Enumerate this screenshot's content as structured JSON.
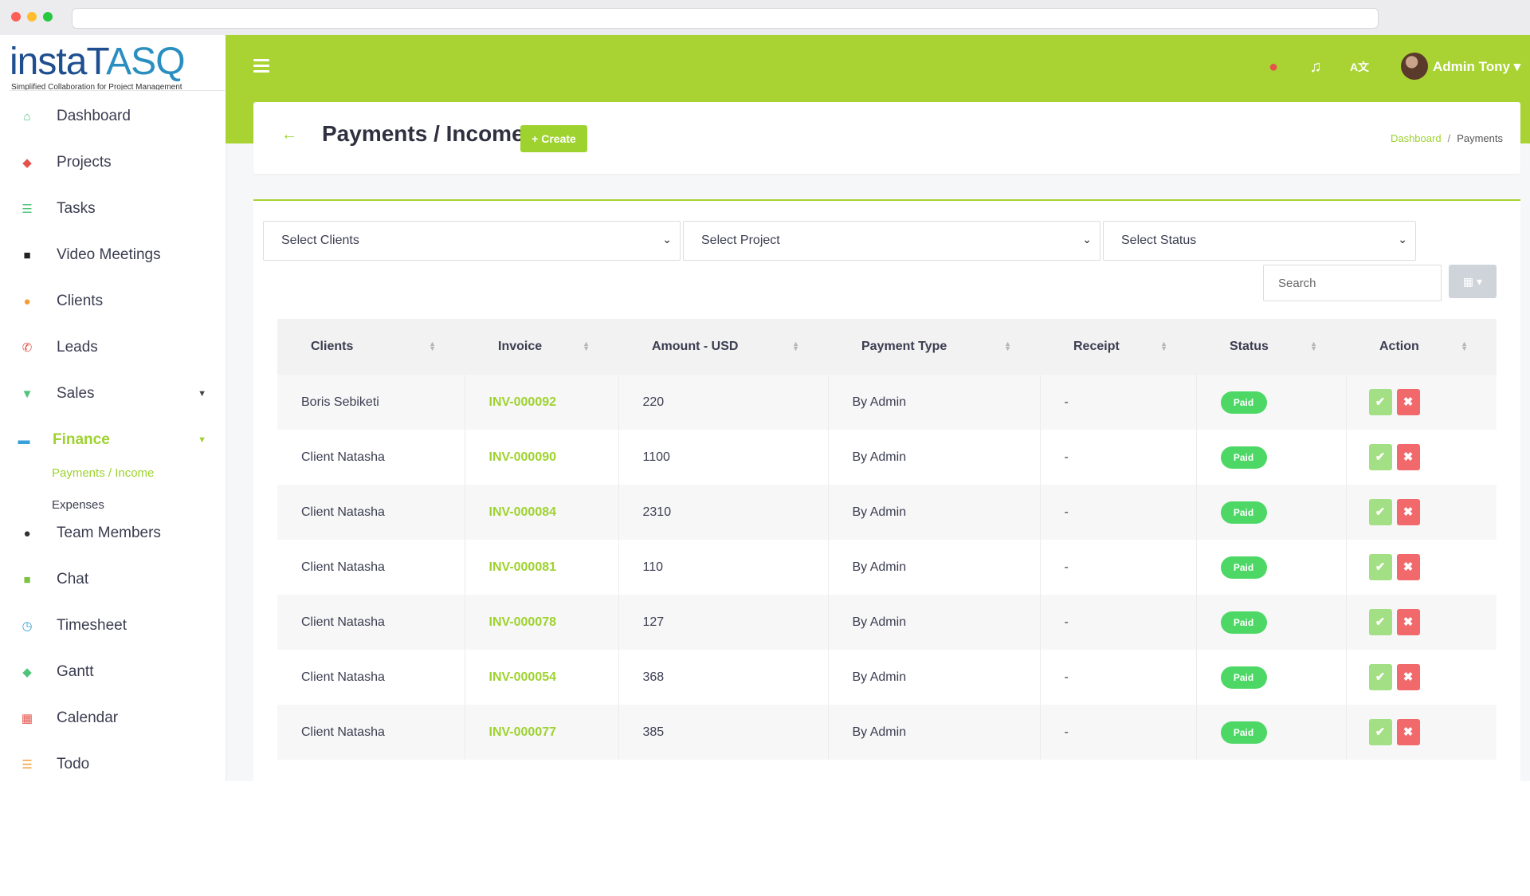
{
  "app": {
    "logo_main": "instaT",
    "logo_accent": "ASQ",
    "logo_tagline": "Simplified Collaboration for Project Management"
  },
  "sidebar": {
    "items": [
      {
        "label": "Dashboard",
        "icon": "home-icon",
        "color": "#4ec47a"
      },
      {
        "label": "Projects",
        "icon": "layers-icon",
        "color": "#e5534b"
      },
      {
        "label": "Tasks",
        "icon": "list-icon",
        "color": "#4ec47a"
      },
      {
        "label": "Video Meetings",
        "icon": "video-icon",
        "color": "#222222"
      },
      {
        "label": "Clients",
        "icon": "handshake-icon",
        "color": "#f39c34"
      },
      {
        "label": "Leads",
        "icon": "phone-icon",
        "color": "#e5534b"
      },
      {
        "label": "Sales",
        "icon": "cart-icon",
        "color": "#4ec47a"
      },
      {
        "label": "Finance",
        "icon": "credit-card-icon",
        "color": "#3aa0d8"
      },
      {
        "label": "Team Members",
        "icon": "users-icon",
        "color": "#333333"
      },
      {
        "label": "Chat",
        "icon": "chat-icon",
        "color": "#7cc243"
      },
      {
        "label": "Timesheet",
        "icon": "clock-icon",
        "color": "#3aa0d8"
      },
      {
        "label": "Gantt",
        "icon": "layers-icon",
        "color": "#4ec47a"
      },
      {
        "label": "Calendar",
        "icon": "calendar-icon",
        "color": "#e5534b"
      },
      {
        "label": "Todo",
        "icon": "list-icon",
        "color": "#f39c34"
      }
    ],
    "finance_sub": [
      "Payments / Income",
      "Expenses"
    ]
  },
  "topbar": {
    "user_name": "Admin Tony ▾",
    "icons": [
      "stopwatch-icon",
      "bell-icon",
      "language-icon"
    ],
    "accent": "#a8d332"
  },
  "header": {
    "title": "Payments / Income",
    "create_label": "+ Create",
    "breadcrumb_home": "Dashboard",
    "breadcrumb_sep": "/",
    "breadcrumb_current": "Payments"
  },
  "filters": {
    "clients": "Select Clients",
    "project": "Select Project",
    "status": "Select Status",
    "search_placeholder": "Search"
  },
  "table": {
    "columns": [
      "Clients",
      "Invoice",
      "Amount - USD",
      "Payment Type",
      "Receipt",
      "Status",
      "Action"
    ],
    "rows": [
      {
        "client": "Boris Sebiketi",
        "invoice": "INV-000092",
        "amount": "220",
        "type": "By Admin",
        "receipt": "-",
        "status": "Paid"
      },
      {
        "client": "Client Natasha",
        "invoice": "INV-000090",
        "amount": "1100",
        "type": "By Admin",
        "receipt": "-",
        "status": "Paid"
      },
      {
        "client": "Client Natasha",
        "invoice": "INV-000084",
        "amount": "2310",
        "type": "By Admin",
        "receipt": "-",
        "status": "Paid"
      },
      {
        "client": "Client Natasha",
        "invoice": "INV-000081",
        "amount": "110",
        "type": "By Admin",
        "receipt": "-",
        "status": "Paid"
      },
      {
        "client": "Client Natasha",
        "invoice": "INV-000078",
        "amount": "127",
        "type": "By Admin",
        "receipt": "-",
        "status": "Paid"
      },
      {
        "client": "Client Natasha",
        "invoice": "INV-000054",
        "amount": "368",
        "type": "By Admin",
        "receipt": "-",
        "status": "Paid"
      },
      {
        "client": "Client Natasha",
        "invoice": "INV-000077",
        "amount": "385",
        "type": "By Admin",
        "receipt": "-",
        "status": "Paid"
      }
    ],
    "approve_glyph": "✔",
    "delete_glyph": "✖"
  }
}
